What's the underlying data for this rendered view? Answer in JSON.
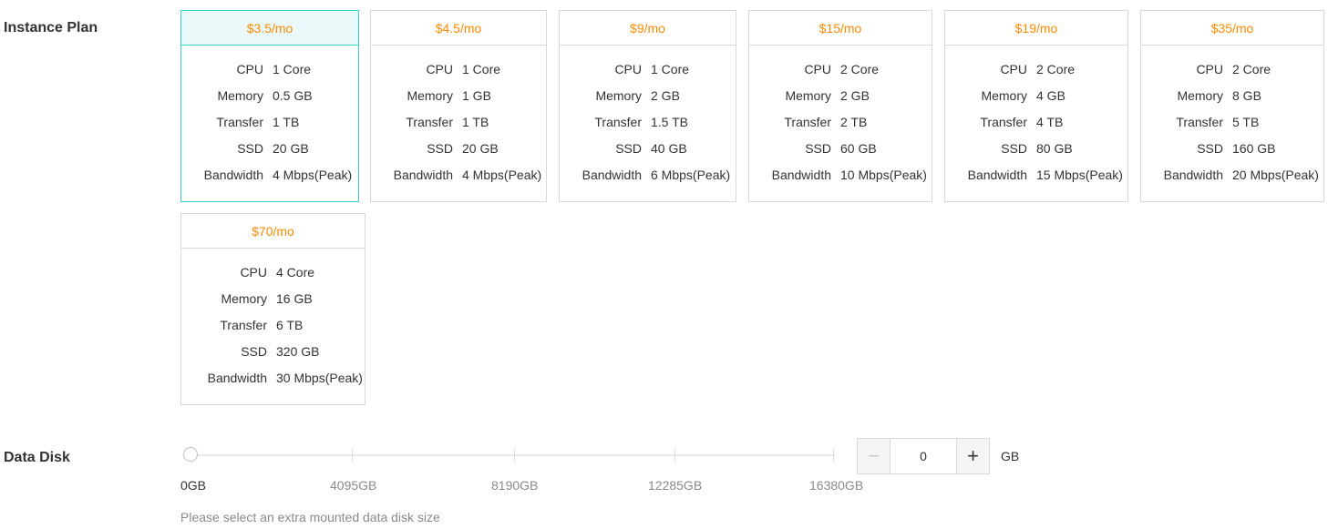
{
  "instance_plan": {
    "label": "Instance Plan",
    "plans": [
      {
        "price": "$3.5/mo",
        "selected": true,
        "specs": [
          [
            "CPU",
            "1 Core"
          ],
          [
            "Memory",
            "0.5 GB"
          ],
          [
            "Transfer",
            "1 TB"
          ],
          [
            "SSD",
            "20 GB"
          ],
          [
            "Bandwidth",
            "4 Mbps(Peak)"
          ]
        ]
      },
      {
        "price": "$4.5/mo",
        "selected": false,
        "specs": [
          [
            "CPU",
            "1 Core"
          ],
          [
            "Memory",
            "1 GB"
          ],
          [
            "Transfer",
            "1 TB"
          ],
          [
            "SSD",
            "20 GB"
          ],
          [
            "Bandwidth",
            "4 Mbps(Peak)"
          ]
        ]
      },
      {
        "price": "$9/mo",
        "selected": false,
        "specs": [
          [
            "CPU",
            "1 Core"
          ],
          [
            "Memory",
            "2 GB"
          ],
          [
            "Transfer",
            "1.5 TB"
          ],
          [
            "SSD",
            "40 GB"
          ],
          [
            "Bandwidth",
            "6 Mbps(Peak)"
          ]
        ]
      },
      {
        "price": "$15/mo",
        "selected": false,
        "specs": [
          [
            "CPU",
            "2 Core"
          ],
          [
            "Memory",
            "2 GB"
          ],
          [
            "Transfer",
            "2 TB"
          ],
          [
            "SSD",
            "60 GB"
          ],
          [
            "Bandwidth",
            "10 Mbps(Peak)"
          ]
        ]
      },
      {
        "price": "$19/mo",
        "selected": false,
        "specs": [
          [
            "CPU",
            "2 Core"
          ],
          [
            "Memory",
            "4 GB"
          ],
          [
            "Transfer",
            "4 TB"
          ],
          [
            "SSD",
            "80 GB"
          ],
          [
            "Bandwidth",
            "15 Mbps(Peak)"
          ]
        ]
      },
      {
        "price": "$35/mo",
        "selected": false,
        "specs": [
          [
            "CPU",
            "2 Core"
          ],
          [
            "Memory",
            "8 GB"
          ],
          [
            "Transfer",
            "5 TB"
          ],
          [
            "SSD",
            "160 GB"
          ],
          [
            "Bandwidth",
            "20 Mbps(Peak)"
          ]
        ]
      },
      {
        "price": "$70/mo",
        "selected": false,
        "specs": [
          [
            "CPU",
            "4 Core"
          ],
          [
            "Memory",
            "16 GB"
          ],
          [
            "Transfer",
            "6 TB"
          ],
          [
            "SSD",
            "320 GB"
          ],
          [
            "Bandwidth",
            "30 Mbps(Peak)"
          ]
        ]
      }
    ]
  },
  "data_disk": {
    "label": "Data Disk",
    "ticks": [
      "0GB",
      "4095GB",
      "8190GB",
      "12285GB",
      "16380GB"
    ],
    "slider_value": 0,
    "slider_max": 16380,
    "input_value": "0",
    "minus_glyph": "−",
    "plus_glyph": "+",
    "unit": "GB",
    "hint": "Please select an extra mounted data disk size"
  },
  "colors": {
    "price": "#ff8a00",
    "selected_border": "#3ccfcf",
    "selected_header_bg": "#e9f8f8"
  }
}
